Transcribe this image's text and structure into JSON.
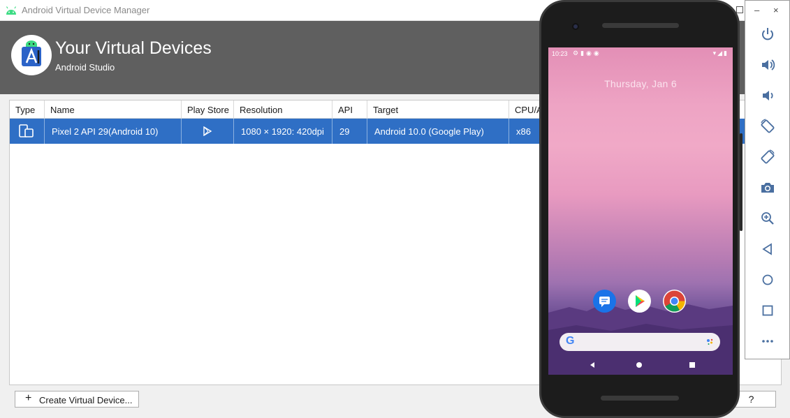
{
  "window": {
    "title": "Android Virtual Device Manager"
  },
  "header": {
    "title": "Your Virtual Devices",
    "subtitle": "Android Studio"
  },
  "table": {
    "columns": [
      "Type",
      "Name",
      "Play Store",
      "Resolution",
      "API",
      "Target",
      "CPU/A"
    ],
    "rows": [
      {
        "type_icon": "phone-tablet-icon",
        "name": "Pixel 2 API 29(Android 10)",
        "play_store_icon": "play-store-icon",
        "resolution": "1080 × 1920: 420dpi",
        "api": "29",
        "target": "Android 10.0 (Google Play)",
        "cpu": "x86"
      }
    ]
  },
  "footer": {
    "create_label": "Create Virtual Device...",
    "help_label": "?"
  },
  "emulator": {
    "status_time": "10:23",
    "lock_date": "Thursday, Jan 6",
    "toolbar": {
      "minimize_label": "–",
      "close_label": "×",
      "buttons": [
        "power-icon",
        "volume-up-icon",
        "volume-down-icon",
        "rotate-left-icon",
        "rotate-right-icon",
        "camera-icon",
        "zoom-in-icon",
        "back-icon",
        "home-icon",
        "overview-icon",
        "more-icon"
      ]
    },
    "home_apps": [
      "messages-icon",
      "play-store-app-icon",
      "chrome-icon"
    ],
    "search_logo": "G"
  },
  "colors": {
    "header_bg": "#5f5f5f",
    "selected_row": "#2f6fc5"
  }
}
